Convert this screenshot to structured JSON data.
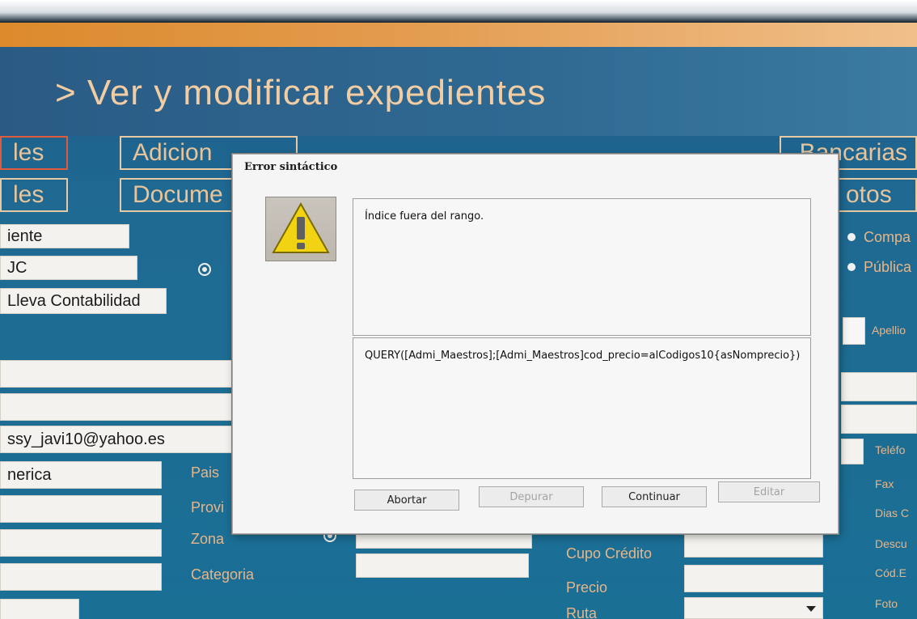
{
  "page": {
    "title": "> Ver y modificar expedientes"
  },
  "tabs_row1": [
    {
      "label": "les"
    },
    {
      "label": "Adicion"
    },
    {
      "label": "Bancarias"
    }
  ],
  "tabs_row2": [
    {
      "label": "les"
    },
    {
      "label": "Docume"
    },
    {
      "label": "otos"
    }
  ],
  "fields": {
    "cliente": "iente",
    "ruc": "JC",
    "lleva_contabilidad": "Lleva Contabilidad",
    "email": "ssy_javi10@yahoo.es",
    "america": "nerica"
  },
  "labels": {
    "pais": "Pais",
    "provincia": "Provi",
    "zona": "Zona",
    "categoria": "Categoria",
    "cupo_credito": "Cupo Crédito",
    "precio": "Precio",
    "ruta": "Ruta",
    "compania": "Compa",
    "publica": "Pública",
    "apellido": "Apellio",
    "telefono": "Teléfo",
    "fax": "Fax",
    "dias": "Dias C",
    "descuento": "Descu",
    "cod": "Cód.E",
    "foto": "Foto"
  },
  "dialog": {
    "title": "Error sintáctico",
    "message": "Índice fuera del rango.",
    "code": "QUERY([Admi_Maestros];[Admi_Maestros]cod_precio=alCodigos10{asNomprecio})",
    "buttons": {
      "abortar": "Abortar",
      "depurar": "Depurar",
      "continuar": "Continuar",
      "editar": "Editar"
    }
  }
}
